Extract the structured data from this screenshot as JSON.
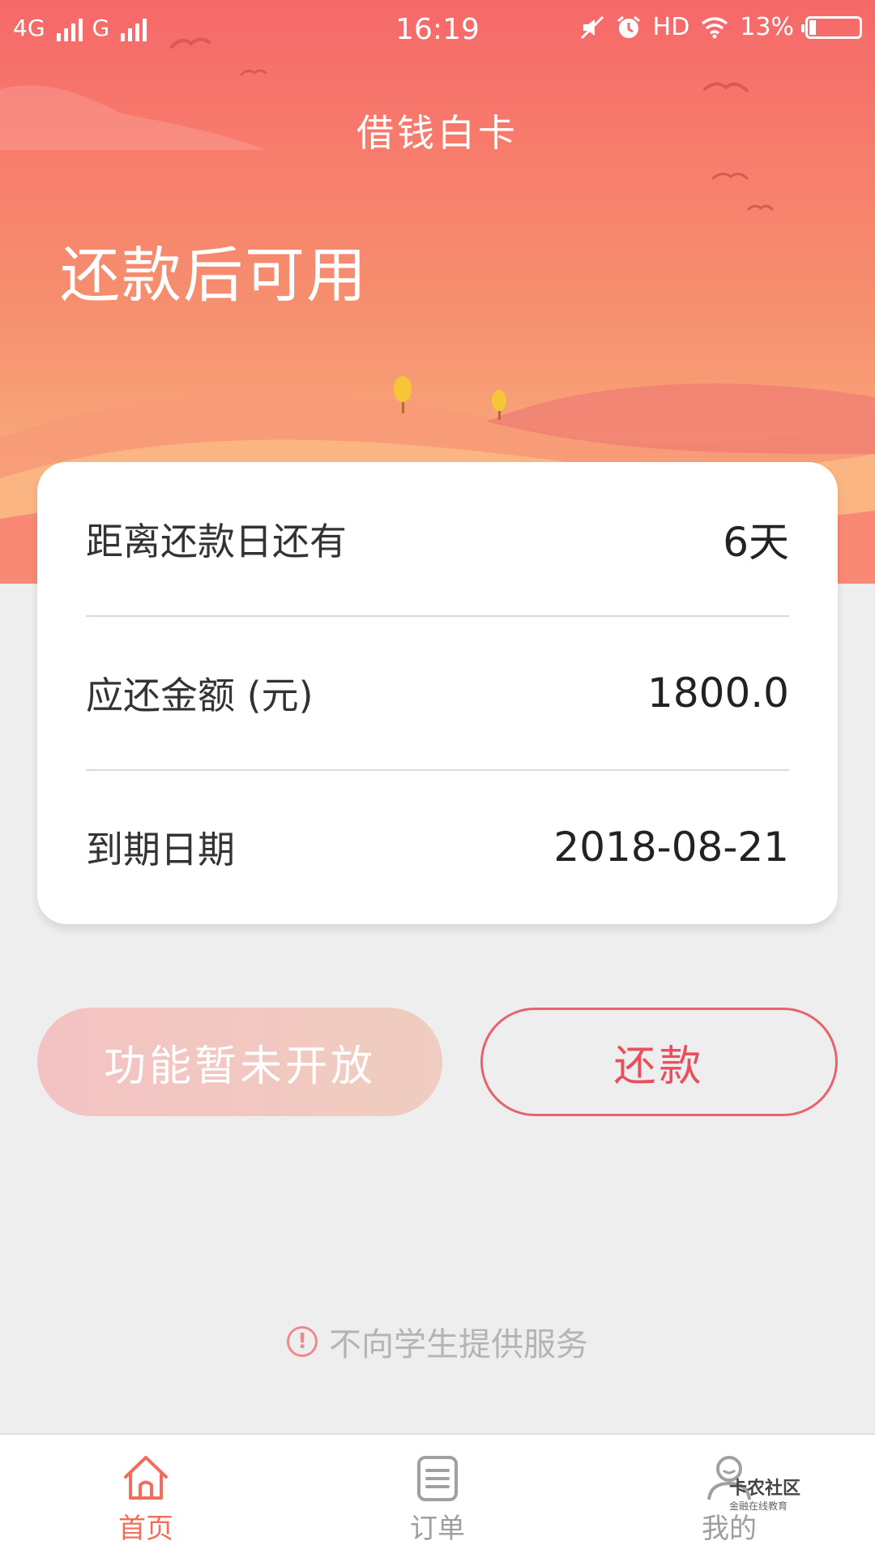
{
  "status_bar": {
    "network1": "4G",
    "network2": "G",
    "time": "16:19",
    "hd": "HD",
    "battery": "13%",
    "battery_level": 0.13
  },
  "header": {
    "title": "借钱白卡",
    "headline": "还款后可用"
  },
  "card": {
    "rows": [
      {
        "label": "距离还款日还有",
        "value": "6天"
      },
      {
        "label": "应还金额 (元)",
        "value": "1800.0"
      },
      {
        "label": "到期日期",
        "value": "2018-08-21"
      }
    ]
  },
  "buttons": {
    "disabled_label": "功能暂未开放",
    "repay_label": "还款"
  },
  "notice": {
    "icon": "!",
    "text": "不向学生提供服务"
  },
  "tabbar": {
    "items": [
      {
        "label": "首页",
        "icon": "home-icon",
        "active": true
      },
      {
        "label": "订单",
        "icon": "order-icon",
        "active": false
      },
      {
        "label": "我的",
        "icon": "user-icon",
        "active": false
      }
    ]
  },
  "watermark": {
    "name": "卡农社区",
    "sub": "金融在线教育"
  },
  "colors": {
    "accent": "#e8505e",
    "tab_active": "#f06e5a",
    "hero_top": "#f6686a",
    "hero_bottom": "#fbc08a"
  }
}
